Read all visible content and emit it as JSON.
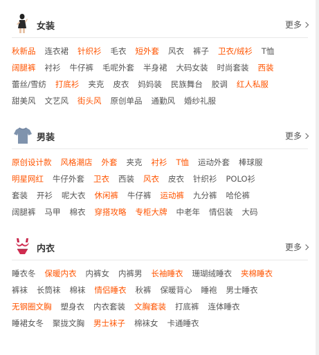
{
  "colors": {
    "accent": "#ff5400",
    "text": "#555555",
    "title": "#333333"
  },
  "sections": [
    {
      "title": "女装",
      "more": "更多",
      "icon": "woman-model-icon",
      "rows": [
        [
          {
            "t": "秋新品",
            "hot": true
          },
          {
            "t": "连衣裙"
          },
          {
            "t": "针织衫",
            "hot": true
          },
          {
            "t": "毛衣"
          },
          {
            "t": "短外套",
            "hot": true
          },
          {
            "t": "风衣"
          },
          {
            "t": "裤子"
          },
          {
            "t": "卫衣/绒衫",
            "hot": true
          },
          {
            "t": "T恤"
          }
        ],
        [
          {
            "t": "阔腿裤",
            "hot": true
          },
          {
            "t": "衬衫"
          },
          {
            "t": "牛仔裤"
          },
          {
            "t": "毛呢外套"
          },
          {
            "t": "半身裙"
          },
          {
            "t": "大码女装"
          },
          {
            "t": "时尚套装"
          },
          {
            "t": "西装",
            "hot": true
          }
        ],
        [
          {
            "t": "蕾丝/雪纺"
          },
          {
            "t": "打底衫",
            "hot": true
          },
          {
            "t": "夹克"
          },
          {
            "t": "皮衣"
          },
          {
            "t": "妈妈装"
          },
          {
            "t": "民族舞台"
          },
          {
            "t": "胶调"
          },
          {
            "t": "红人私服",
            "hot": true
          }
        ],
        [
          {
            "t": "甜美风"
          },
          {
            "t": "文艺风"
          },
          {
            "t": "街头风",
            "hot": true
          },
          {
            "t": "原创单品"
          },
          {
            "t": "通勤风"
          },
          {
            "t": "婚纱礼服"
          }
        ]
      ]
    },
    {
      "title": "男装",
      "more": "更多",
      "icon": "tshirt-icon",
      "rows": [
        [
          {
            "t": "原创设计款",
            "hot": true
          },
          {
            "t": "风格潮店",
            "hot": true
          },
          {
            "t": "外套",
            "hot": true
          },
          {
            "t": "夹克"
          },
          {
            "t": "衬衫",
            "hot": true
          },
          {
            "t": "T恤",
            "hot": true
          },
          {
            "t": "运动外套"
          },
          {
            "t": "棒球服"
          }
        ],
        [
          {
            "t": "明星网红",
            "hot": true
          },
          {
            "t": "牛仔外套"
          },
          {
            "t": "卫衣",
            "hot": true
          },
          {
            "t": "西装"
          },
          {
            "t": "风衣",
            "hot": true
          },
          {
            "t": "皮衣"
          },
          {
            "t": "针织衫"
          },
          {
            "t": "POLO衫"
          }
        ],
        [
          {
            "t": "套装"
          },
          {
            "t": "开衫"
          },
          {
            "t": "呢大衣"
          },
          {
            "t": "休闲裤",
            "hot": true
          },
          {
            "t": "牛仔裤"
          },
          {
            "t": "运动裤",
            "hot": true
          },
          {
            "t": "九分裤"
          },
          {
            "t": "哈伦裤"
          }
        ],
        [
          {
            "t": "阔腿裤"
          },
          {
            "t": "马甲"
          },
          {
            "t": "棉衣"
          },
          {
            "t": "穿搭攻略",
            "hot": true
          },
          {
            "t": "专柜大牌",
            "hot": true
          },
          {
            "t": "中老年"
          },
          {
            "t": "情侣装"
          },
          {
            "t": "大码"
          }
        ]
      ]
    },
    {
      "title": "内衣",
      "more": "更多",
      "icon": "lingerie-icon",
      "rows": [
        [
          {
            "t": "睡衣冬"
          },
          {
            "t": "保暖内衣",
            "hot": true
          },
          {
            "t": "内裤女"
          },
          {
            "t": "内裤男"
          },
          {
            "t": "长袖睡衣",
            "hot": true
          },
          {
            "t": "珊瑚绒睡衣"
          },
          {
            "t": "夹棉睡衣",
            "hot": true
          }
        ],
        [
          {
            "t": "裤袜"
          },
          {
            "t": "长筒袜"
          },
          {
            "t": "棉袜"
          },
          {
            "t": "情侣睡衣",
            "hot": true
          },
          {
            "t": "秋裤"
          },
          {
            "t": "保暖背心"
          },
          {
            "t": "睡袍"
          },
          {
            "t": "男士睡衣"
          }
        ],
        [
          {
            "t": "无钢圈文胸",
            "hot": true
          },
          {
            "t": "塑身衣"
          },
          {
            "t": "内衣套装"
          },
          {
            "t": "文胸套装",
            "hot": true
          },
          {
            "t": "打底裤"
          },
          {
            "t": "连体睡衣"
          }
        ],
        [
          {
            "t": "睡裙女冬"
          },
          {
            "t": "聚拢文胸"
          },
          {
            "t": "男士袜子",
            "hot": true
          },
          {
            "t": "棉袜女"
          },
          {
            "t": "卡通睡衣"
          }
        ]
      ]
    }
  ]
}
